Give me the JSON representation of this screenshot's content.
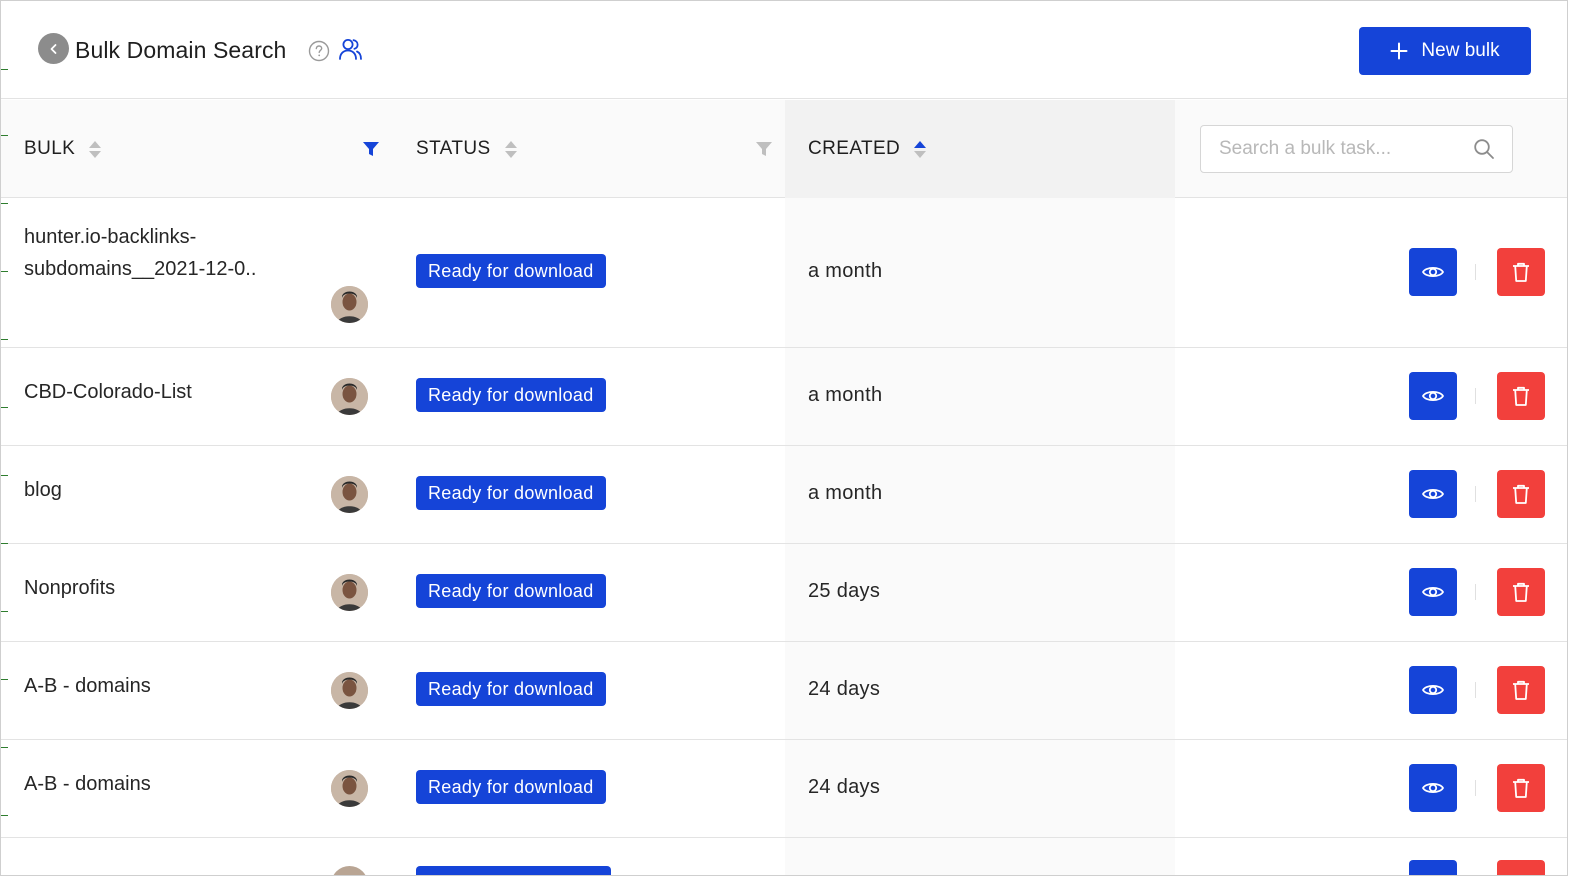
{
  "header": {
    "title": "Bulk Domain Search",
    "new_bulk_label": "New bulk",
    "icons": {
      "back": "chevron-left-icon",
      "help": "question-circle-icon",
      "team": "users-icon",
      "add": "plus-icon"
    }
  },
  "table": {
    "columns": {
      "bulk": "BULK",
      "status": "STATUS",
      "created": "CREATED"
    },
    "sort": {
      "column": "created",
      "direction": "ascending"
    },
    "search_placeholder": "Search a bulk task...",
    "rows": [
      {
        "name_line1": "hunter.io-backlinks-",
        "name_line2": "subdomains__2021-12-0..",
        "status": "Ready for download",
        "created": "a month"
      },
      {
        "name_line1": "CBD-Colorado-List",
        "name_line2": "",
        "status": "Ready for download",
        "created": "a month"
      },
      {
        "name_line1": "blog",
        "name_line2": "",
        "status": "Ready for download",
        "created": "a month"
      },
      {
        "name_line1": "Nonprofits",
        "name_line2": "",
        "status": "Ready for download",
        "created": "25 days"
      },
      {
        "name_line1": "A-B - domains",
        "name_line2": "",
        "status": "Ready for download",
        "created": "24 days"
      },
      {
        "name_line1": "A-B - domains",
        "name_line2": "",
        "status": "Ready for download",
        "created": "24 days"
      }
    ]
  },
  "colors": {
    "primary": "#1544d8",
    "danger": "#f2403c",
    "header_bg": "#fafafa"
  }
}
